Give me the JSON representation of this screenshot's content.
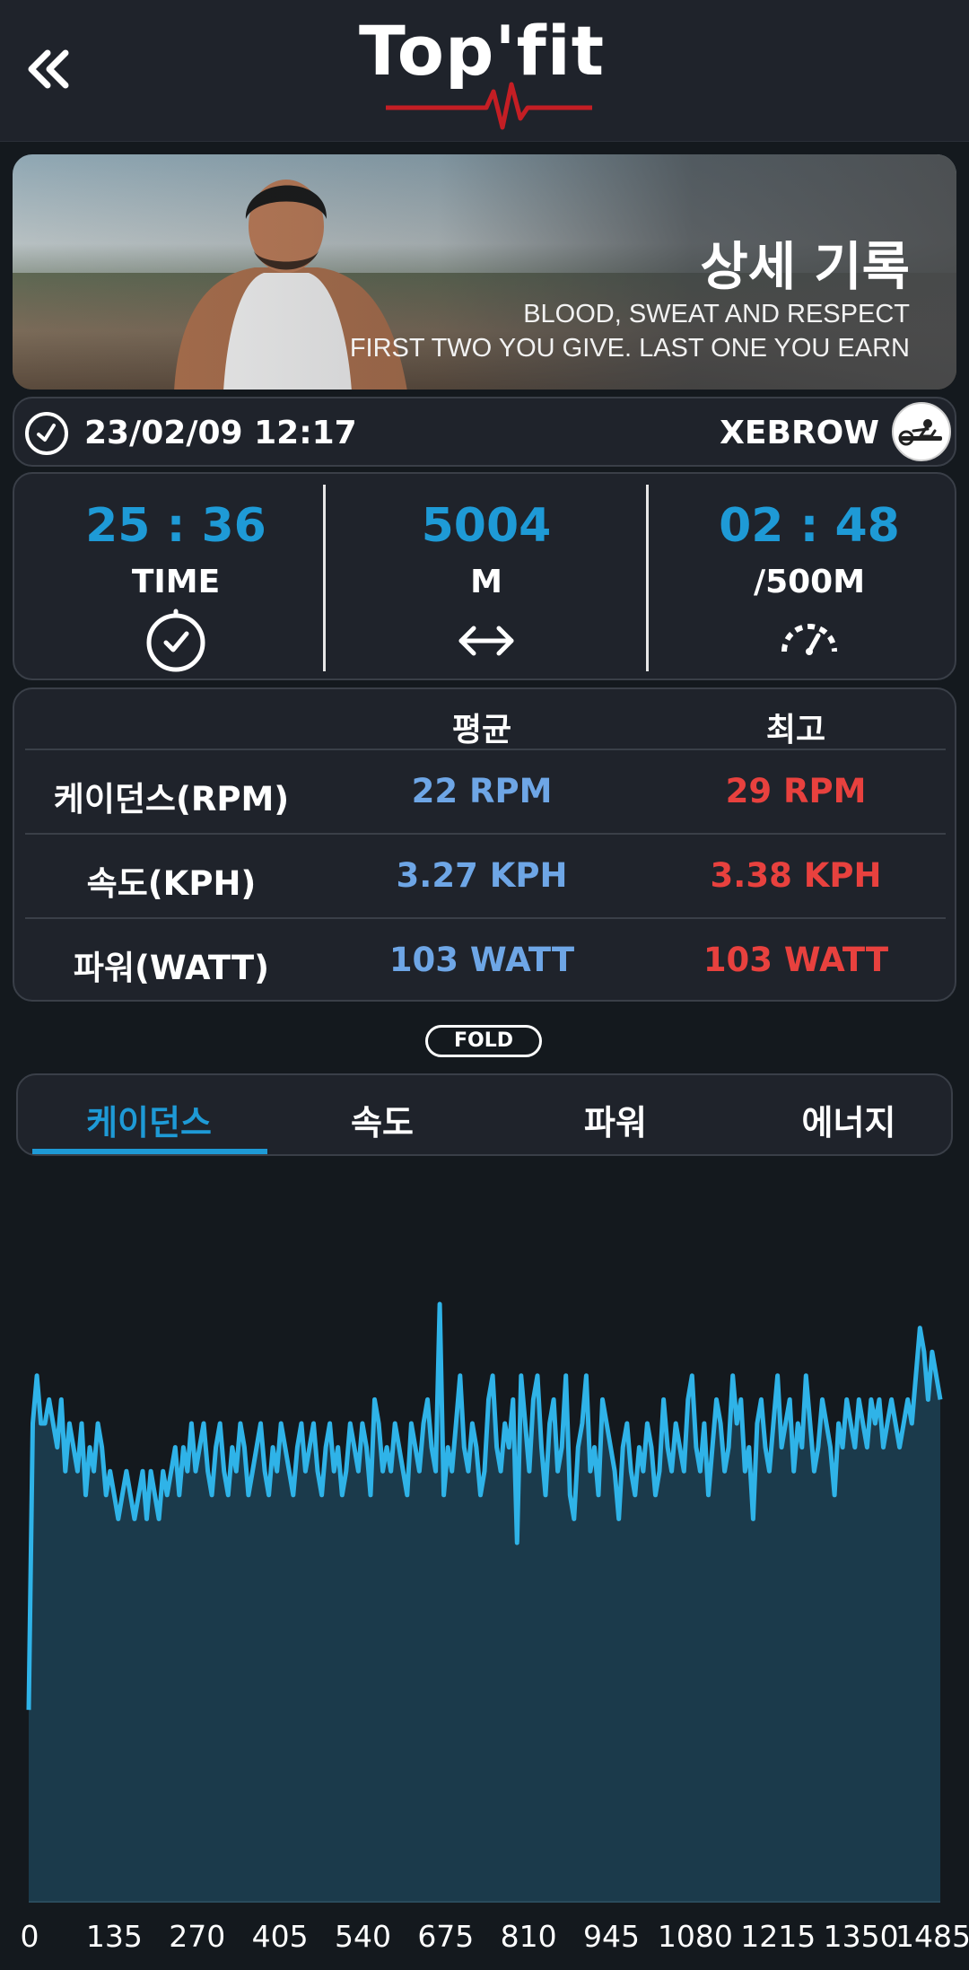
{
  "header": {
    "back_icon": "double-chevron-left-icon",
    "logo_text": "Top'fit",
    "logo_color": "#ffffff",
    "pulse_color": "#c41e24"
  },
  "hero": {
    "title": "상세 기록",
    "subtitle_line1": "BLOOD, SWEAT AND RESPECT",
    "subtitle_line2": "FIRST TWO YOU GIVE. LAST ONE YOU EARN"
  },
  "session": {
    "datetime": "23/02/09 12:17",
    "clock_icon": "clock-icon",
    "device": "XEBROW",
    "device_icon": "rowing-machine-icon"
  },
  "stats": [
    {
      "value": "25 : 36",
      "label": "TIME",
      "icon": "stopwatch-icon"
    },
    {
      "value": "5004",
      "label": "M",
      "icon": "double-arrow-horizontal-icon"
    },
    {
      "value": "02 : 48",
      "label": "/500M",
      "icon": "speedometer-icon"
    }
  ],
  "summary_table": {
    "headers": [
      "",
      "평균",
      "최고"
    ],
    "rows": [
      {
        "label": "케이던스(RPM)",
        "avg": "22 RPM",
        "max": "29 RPM"
      },
      {
        "label": "속도(KPH)",
        "avg": "3.27 KPH",
        "max": "3.38 KPH"
      },
      {
        "label": "파워(WATT)",
        "avg": "103 WATT",
        "max": "103 WATT"
      }
    ]
  },
  "fold_label": "FOLD",
  "tabs": [
    {
      "label": "케이던스",
      "active": true
    },
    {
      "label": "속도",
      "active": false
    },
    {
      "label": "파워",
      "active": false
    },
    {
      "label": "에너지",
      "active": false
    }
  ],
  "colors": {
    "accent": "#1e9ad6",
    "avg": "#6ea6e6",
    "max": "#e8413e",
    "card_bg": "#1f232b",
    "page_bg": "#14191e",
    "chart_line": "#2fb3e8",
    "chart_fill": "#1b3a4b"
  },
  "chart_data": {
    "type": "area",
    "title": "",
    "xlabel": "",
    "ylabel": "",
    "x_ticks": [
      "0",
      "135",
      "270",
      "405",
      "540",
      "675",
      "810",
      "945",
      "1080",
      "1215",
      "1350",
      "1485"
    ],
    "xlim": [
      0,
      1485
    ],
    "ylim": [
      0,
      30
    ],
    "grid": false,
    "legend": "none",
    "series": [
      {
        "values": [
          8,
          20,
          22,
          20,
          20,
          21,
          20,
          19,
          21,
          18,
          20,
          19,
          18,
          20,
          17,
          19,
          18,
          20,
          19,
          17,
          18,
          17,
          16,
          17,
          18,
          17,
          16,
          17,
          18,
          16,
          18,
          17,
          16,
          18,
          17,
          18,
          19,
          17,
          19,
          18,
          20,
          18,
          19,
          20,
          18,
          17,
          19,
          20,
          18,
          17,
          19,
          18,
          20,
          19,
          17,
          18,
          19,
          20,
          18,
          17,
          19,
          18,
          20,
          19,
          18,
          17,
          19,
          20,
          18,
          19,
          20,
          18,
          17,
          19,
          20,
          18,
          19,
          17,
          18,
          20,
          19,
          18,
          20,
          19,
          17,
          21,
          20,
          18,
          19,
          18,
          20,
          19,
          18,
          17,
          20,
          19,
          18,
          20,
          21,
          19,
          18,
          25,
          17,
          19,
          18,
          20,
          22,
          19,
          18,
          20,
          19,
          17,
          18,
          21,
          22,
          19,
          18,
          20,
          19,
          21,
          15,
          22,
          20,
          18,
          21,
          22,
          19,
          17,
          20,
          21,
          18,
          19,
          22,
          17,
          16,
          19,
          20,
          22,
          18,
          19,
          17,
          21,
          20,
          19,
          18,
          16,
          19,
          20,
          18,
          17,
          19,
          18,
          20,
          19,
          17,
          18,
          21,
          19,
          18,
          20,
          19,
          18,
          21,
          22,
          19,
          18,
          20,
          17,
          19,
          21,
          20,
          18,
          19,
          22,
          20,
          21,
          18,
          19,
          16,
          20,
          21,
          19,
          18,
          20,
          22,
          19,
          20,
          21,
          18,
          20,
          19,
          22,
          20,
          18,
          19,
          21,
          20,
          19,
          17,
          20,
          19,
          21,
          20,
          19,
          21,
          20,
          19,
          21,
          20,
          21,
          19,
          20,
          21,
          20,
          19,
          20,
          21,
          20,
          22,
          24,
          23,
          21,
          23,
          22,
          21
        ]
      }
    ]
  }
}
